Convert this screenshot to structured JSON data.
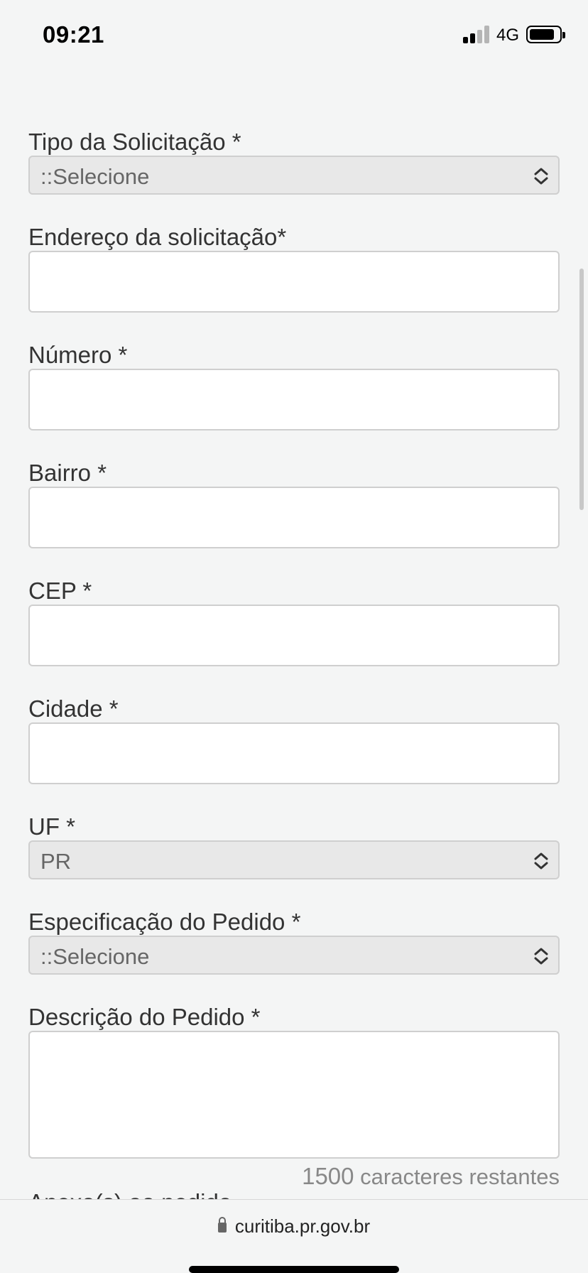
{
  "status_bar": {
    "time": "09:21",
    "network": "4G",
    "signal_bars_filled": 2,
    "signal_bars_total": 4,
    "battery_level": 0.75
  },
  "form": {
    "tipo": {
      "label": "Tipo da Solicitação *",
      "value": "::Selecione"
    },
    "endereco": {
      "label": "Endereço da solicitação*"
    },
    "numero": {
      "label": "Número *"
    },
    "bairro": {
      "label": "Bairro *"
    },
    "cep": {
      "label": "CEP *"
    },
    "cidade": {
      "label": "Cidade *"
    },
    "uf": {
      "label": "UF *",
      "value": "PR"
    },
    "especificacao": {
      "label": "Especificação do Pedido *",
      "value": "::Selecione"
    },
    "descricao": {
      "label": "Descrição do Pedido *"
    },
    "counter": {
      "count": "1500",
      "text": "caracteres restantes"
    },
    "next_label_partial": "Anexo(s) ao pedido"
  },
  "browser": {
    "url": "curitiba.pr.gov.br"
  },
  "icons": {
    "select_chevron": "chevron-up-down-icon",
    "lock": "lock-icon"
  },
  "colors": {
    "background": "#f4f5f5",
    "select_bg": "#e8e8e8",
    "input_bg": "#ffffff",
    "border": "#cfcfcf"
  }
}
